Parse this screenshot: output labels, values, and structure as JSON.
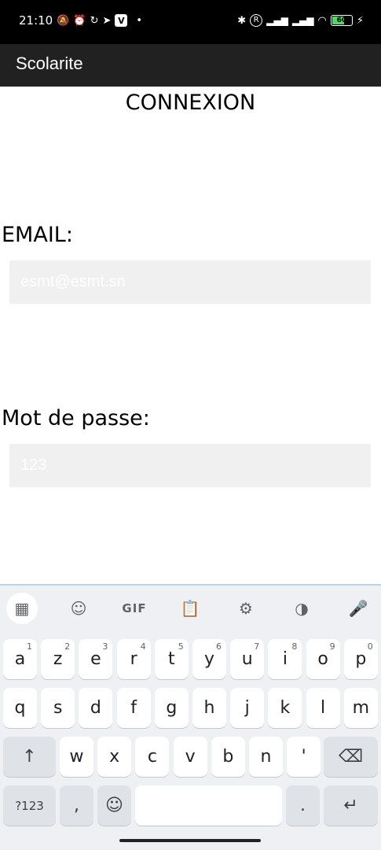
{
  "status_bar": {
    "time": "21:10",
    "left_icons": [
      "mute-icon",
      "alarm-icon",
      "sync-icon",
      "telegram-icon",
      "app-icon",
      "dot-icon"
    ],
    "right_icons": [
      "bluetooth-icon",
      "r-icon",
      "signal-icon",
      "signal-icon",
      "wifi-icon"
    ],
    "battery_level": "60"
  },
  "app_bar": {
    "title": "Scolarite"
  },
  "page": {
    "title": "CONNEXION",
    "email_label": "EMAIL:",
    "email_placeholder": "esmt@esmt.sn",
    "password_label": "Mot de passe:",
    "password_placeholder": "123"
  },
  "keyboard": {
    "toolbar": [
      "apps-icon",
      "sticker-icon",
      "GIF",
      "clipboard-icon",
      "settings-icon",
      "palette-icon",
      "mic-icon"
    ],
    "row1": [
      {
        "key": "a",
        "hint": "1"
      },
      {
        "key": "z",
        "hint": "2"
      },
      {
        "key": "e",
        "hint": "3"
      },
      {
        "key": "r",
        "hint": "4"
      },
      {
        "key": "t",
        "hint": "5"
      },
      {
        "key": "y",
        "hint": "6"
      },
      {
        "key": "u",
        "hint": "7"
      },
      {
        "key": "i",
        "hint": "8"
      },
      {
        "key": "o",
        "hint": "9"
      },
      {
        "key": "p",
        "hint": "0"
      }
    ],
    "row2": [
      "q",
      "s",
      "d",
      "f",
      "g",
      "h",
      "j",
      "k",
      "l",
      "m"
    ],
    "row3": [
      "w",
      "x",
      "c",
      "v",
      "b",
      "n",
      "'"
    ],
    "row4": {
      "symbols": "?123",
      "comma": ",",
      "period": "."
    }
  }
}
